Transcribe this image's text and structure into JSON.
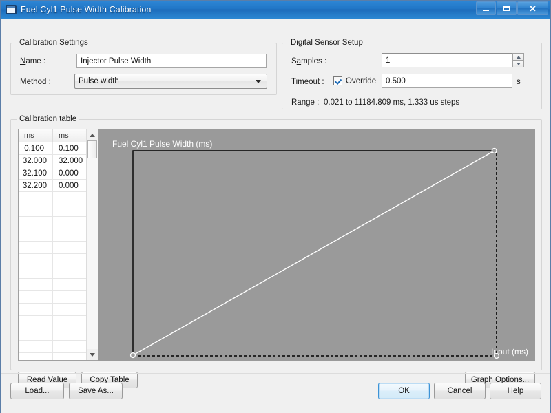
{
  "window": {
    "title": "Fuel Cyl1 Pulse Width Calibration",
    "icon": "window-icon",
    "controls": {
      "minimize": "minimize-icon",
      "maximize": "maximize-icon",
      "close": "✕"
    }
  },
  "calibration_settings": {
    "group_title": "Calibration Settings",
    "name_label_pre": "N",
    "name_label_post": "ame :",
    "name_value": "Injector Pulse Width",
    "method_label_pre": "M",
    "method_label_post": "ethod :",
    "method_value": "Pulse width"
  },
  "digital_sensor_setup": {
    "group_title": "Digital Sensor Setup",
    "samples_label_pre": "S",
    "samples_label_acc": "a",
    "samples_label_post": "mples :",
    "samples_value": "1",
    "timeout_label_pre": "T",
    "timeout_label_post": "imeout :",
    "override_label": "Override",
    "override_checked": true,
    "timeout_value": "0.500",
    "timeout_units": "s",
    "range_label": "Range :",
    "range_value": "0.021 to 11184.809 ms, 1.333 us steps"
  },
  "calibration_table": {
    "group_title": "Calibration table",
    "columns": [
      "ms",
      "ms"
    ],
    "rows": [
      [
        "0.100",
        "0.100"
      ],
      [
        "32.000",
        "32.000"
      ],
      [
        "32.100",
        "0.000"
      ],
      [
        "32.200",
        "0.000"
      ]
    ],
    "empty_row_count": 15
  },
  "chart_data": {
    "type": "line",
    "title": "Fuel Cyl1 Pulse Width (ms)",
    "xlabel": "Input (ms)",
    "ylabel": "",
    "x": [
      0.1,
      32.0,
      32.1,
      32.2
    ],
    "y": [
      0.1,
      32.0,
      0.0,
      0.0
    ],
    "xlim": [
      0.1,
      32.2
    ],
    "ylim": [
      0.0,
      32.0
    ],
    "grid": false,
    "legend": "none",
    "line_color": "#ffffff",
    "marker_color": "#ffffff",
    "frame_color": "#000000",
    "background": "#9a9a9a",
    "annotations": [
      {
        "name": "start-marker",
        "x": 0.1,
        "y": 0.1
      },
      {
        "name": "peak-marker",
        "x": 32.0,
        "y": 32.0
      },
      {
        "name": "end-marker",
        "x": 32.2,
        "y": 0.0
      }
    ]
  },
  "buttons": {
    "read_value": "Read Value",
    "copy_table": "Copy Table",
    "graph_options": "Graph Options...",
    "load": "Load...",
    "save_as": "Save As...",
    "ok": "OK",
    "cancel": "Cancel",
    "help": "Help"
  }
}
